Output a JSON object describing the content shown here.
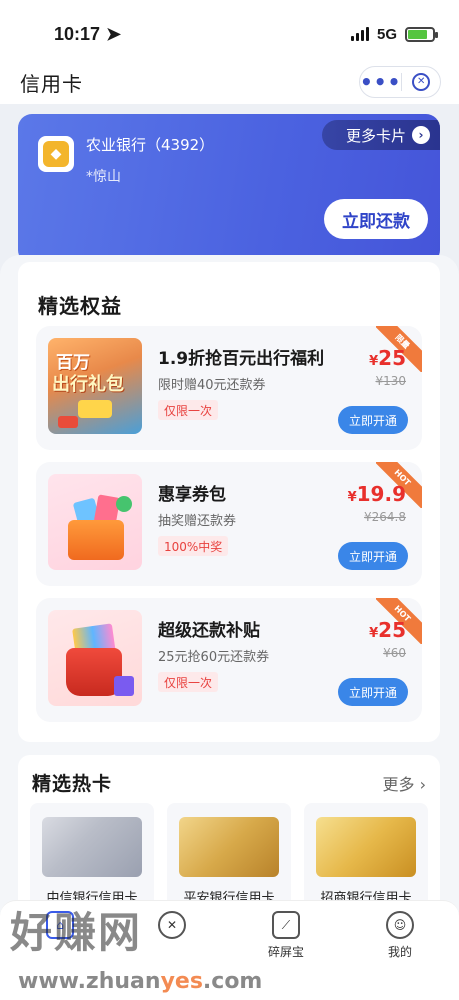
{
  "status_bar": {
    "time": "10:17",
    "network": "5G"
  },
  "nav": {
    "title": "信用卡",
    "more_label": "•••"
  },
  "card": {
    "bank_name": "农业银行（4392）",
    "holder": "*惊山",
    "more_cards_label": "更多卡片",
    "repay_label": "立即还款"
  },
  "benefits": {
    "title": "精选权益",
    "items": [
      {
        "title": "1.9折抢百元出行福利",
        "subtitle": "限时赠40元还款券",
        "tag": "仅限一次",
        "ribbon": "限量",
        "currency": "¥",
        "price": "25",
        "original_price": "¥130",
        "button": "立即开通",
        "img_text1": "百万",
        "img_text2": "出行礼包"
      },
      {
        "title": "惠享券包",
        "subtitle": "抽奖赠还款券",
        "tag": "100%中奖",
        "ribbon": "HOT",
        "currency": "¥",
        "price": "19.9",
        "original_price": "¥264.8",
        "button": "立即开通"
      },
      {
        "title": "超级还款补贴",
        "subtitle": "25元抢60元还款券",
        "tag": "仅限一次",
        "ribbon": "HOT",
        "currency": "¥",
        "price": "25",
        "original_price": "¥60",
        "button": "立即开通"
      }
    ]
  },
  "hot_cards": {
    "title": "精选热卡",
    "more_label": "更多 ›",
    "items": [
      {
        "name": "中信银行信用卡"
      },
      {
        "name": "平安银行信用卡"
      },
      {
        "name": "招商银行信用卡"
      }
    ]
  },
  "tab_bar": {
    "items": [
      {
        "label": ""
      },
      {
        "label": ""
      },
      {
        "label": "碎屏宝"
      },
      {
        "label": "我的"
      }
    ]
  },
  "watermark": {
    "text": "好赚网",
    "url_prefix": "www.zhuan",
    "url_highlight": "yes",
    "url_suffix": ".com"
  }
}
